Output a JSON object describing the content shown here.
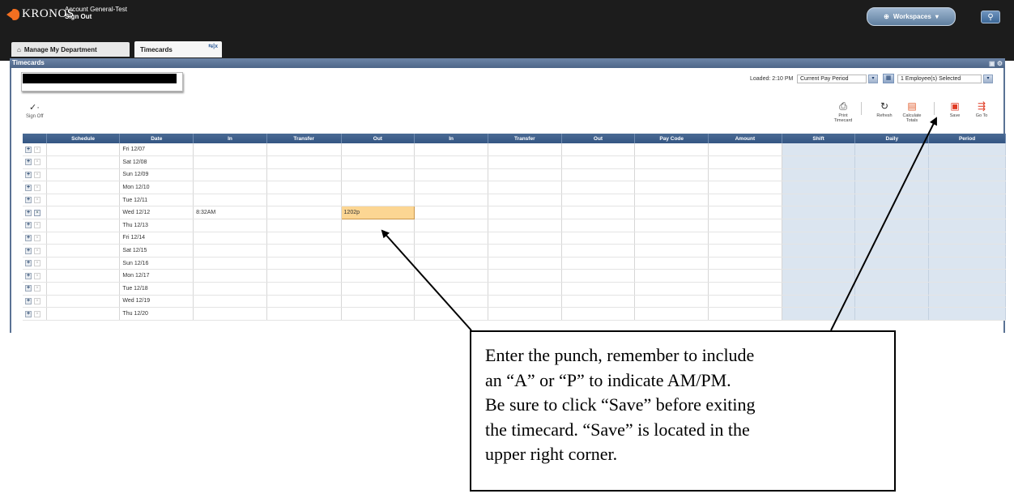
{
  "header": {
    "logo_text": "KRONOS",
    "account_name": "Account General-Test",
    "sign_out": "Sign Out",
    "workspaces_label": "Workspaces"
  },
  "tabs": [
    {
      "label": "Manage My Department"
    },
    {
      "label": "Timecards"
    }
  ],
  "panel": {
    "title": "Timecards",
    "loaded_text": "Loaded: 2:10 PM",
    "period_value": "Current Pay Period",
    "employees_value": "1 Employee(s) Selected"
  },
  "toolbar": {
    "sign_off": "Sign Off",
    "print_timecard": "Print Timecard",
    "refresh": "Refresh",
    "calculate_totals": "Calculate Totals",
    "save": "Save",
    "go_to": "Go To"
  },
  "grid": {
    "columns": [
      "Schedule",
      "Date",
      "In",
      "Transfer",
      "Out",
      "In",
      "Transfer",
      "Out",
      "Pay Code",
      "Amount",
      "Shift",
      "Daily",
      "Period"
    ],
    "rows": [
      {
        "date": "Fri 12/07",
        "in": "",
        "out": ""
      },
      {
        "date": "Sat 12/08",
        "in": "",
        "out": ""
      },
      {
        "date": "Sun 12/09",
        "in": "",
        "out": ""
      },
      {
        "date": "Mon 12/10",
        "in": "",
        "out": ""
      },
      {
        "date": "Tue 12/11",
        "in": "",
        "out": ""
      },
      {
        "date": "Wed 12/12",
        "in": "8:32AM",
        "out": "1202p"
      },
      {
        "date": "Thu 12/13",
        "in": "",
        "out": ""
      },
      {
        "date": "Fri 12/14",
        "in": "",
        "out": ""
      },
      {
        "date": "Sat 12/15",
        "in": "",
        "out": ""
      },
      {
        "date": "Sun 12/16",
        "in": "",
        "out": ""
      },
      {
        "date": "Mon 12/17",
        "in": "",
        "out": ""
      },
      {
        "date": "Tue 12/18",
        "in": "",
        "out": ""
      },
      {
        "date": "Wed 12/19",
        "in": "",
        "out": ""
      },
      {
        "date": "Thu 12/20",
        "in": "",
        "out": ""
      }
    ]
  },
  "callout": {
    "lines": [
      "Enter the punch, remember to include",
      "an “A” or “P” to indicate AM/PM.",
      "Be sure to click “Save” before exiting",
      "the timecard.  “Save” is located in the",
      "upper right corner."
    ]
  },
  "icons": {
    "sign_off": "sign-off-icon",
    "print": "printer-icon",
    "refresh": "refresh-icon",
    "calculate": "calculator-icon",
    "save": "save-icon",
    "go_to": "go-to-icon",
    "search": "search-icon",
    "add_row": "plus-icon",
    "delete_row": "delete-icon"
  },
  "colors": {
    "topbar": "#1c1c1c",
    "header_blue": "#345583",
    "total_cells": "#dbe5f0",
    "edit_cell": "#fcd693",
    "accent_orange": "#f36f21",
    "save_red": "#e03b24"
  }
}
